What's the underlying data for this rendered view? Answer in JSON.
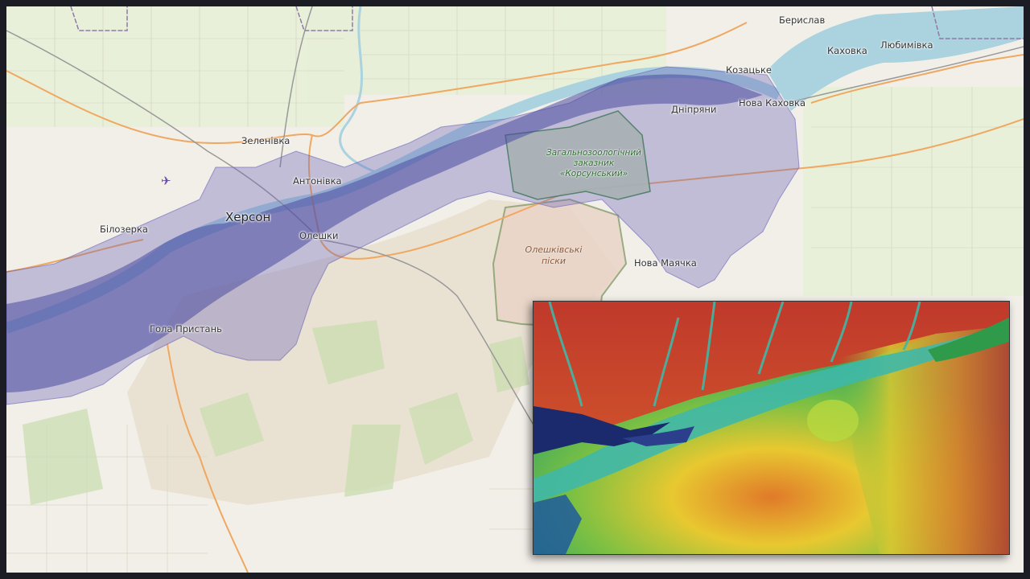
{
  "places": [
    {
      "id": "beryslav",
      "name": "Берислав",
      "type": "town"
    },
    {
      "id": "kakhovka",
      "name": "Каховка",
      "type": "town"
    },
    {
      "id": "liubymivka",
      "name": "Любимівка",
      "type": "town"
    },
    {
      "id": "kozatske",
      "name": "Козацьке",
      "type": "town"
    },
    {
      "id": "nova_kakhovka",
      "name": "Нова Каховка",
      "type": "town"
    },
    {
      "id": "dnipriany",
      "name": "Дніпряни",
      "type": "town"
    },
    {
      "id": "zelenivka",
      "name": "Зеленівка",
      "type": "town"
    },
    {
      "id": "antonivka",
      "name": "Антонівка",
      "type": "town"
    },
    {
      "id": "kherson",
      "name": "Херсон",
      "type": "city"
    },
    {
      "id": "oleshky",
      "name": "Олешки",
      "type": "town"
    },
    {
      "id": "bilozerka",
      "name": "Білозерка",
      "type": "town"
    },
    {
      "id": "hola_prystan",
      "name": "Гола Пристань",
      "type": "town"
    },
    {
      "id": "nova_maiachka",
      "name": "Нова Маячка",
      "type": "town"
    }
  ],
  "reserve": {
    "line1": "Загальнозоологічний",
    "line2": "заказник",
    "line3": "«Корсунський»"
  },
  "sands": {
    "line1": "Олешківські",
    "line2": "піски"
  },
  "legend": {
    "flood_zone_color": "#6a62b8",
    "river_color": "#aad3df",
    "reserve_color": "#3a8a3a"
  },
  "icons": {
    "airport": "airplane-icon"
  },
  "inset": {
    "description_colors": {
      "high": "#c0392b",
      "mid": "#7bc043",
      "low": "#1f7a8c",
      "water": "#1a2a6c"
    }
  }
}
